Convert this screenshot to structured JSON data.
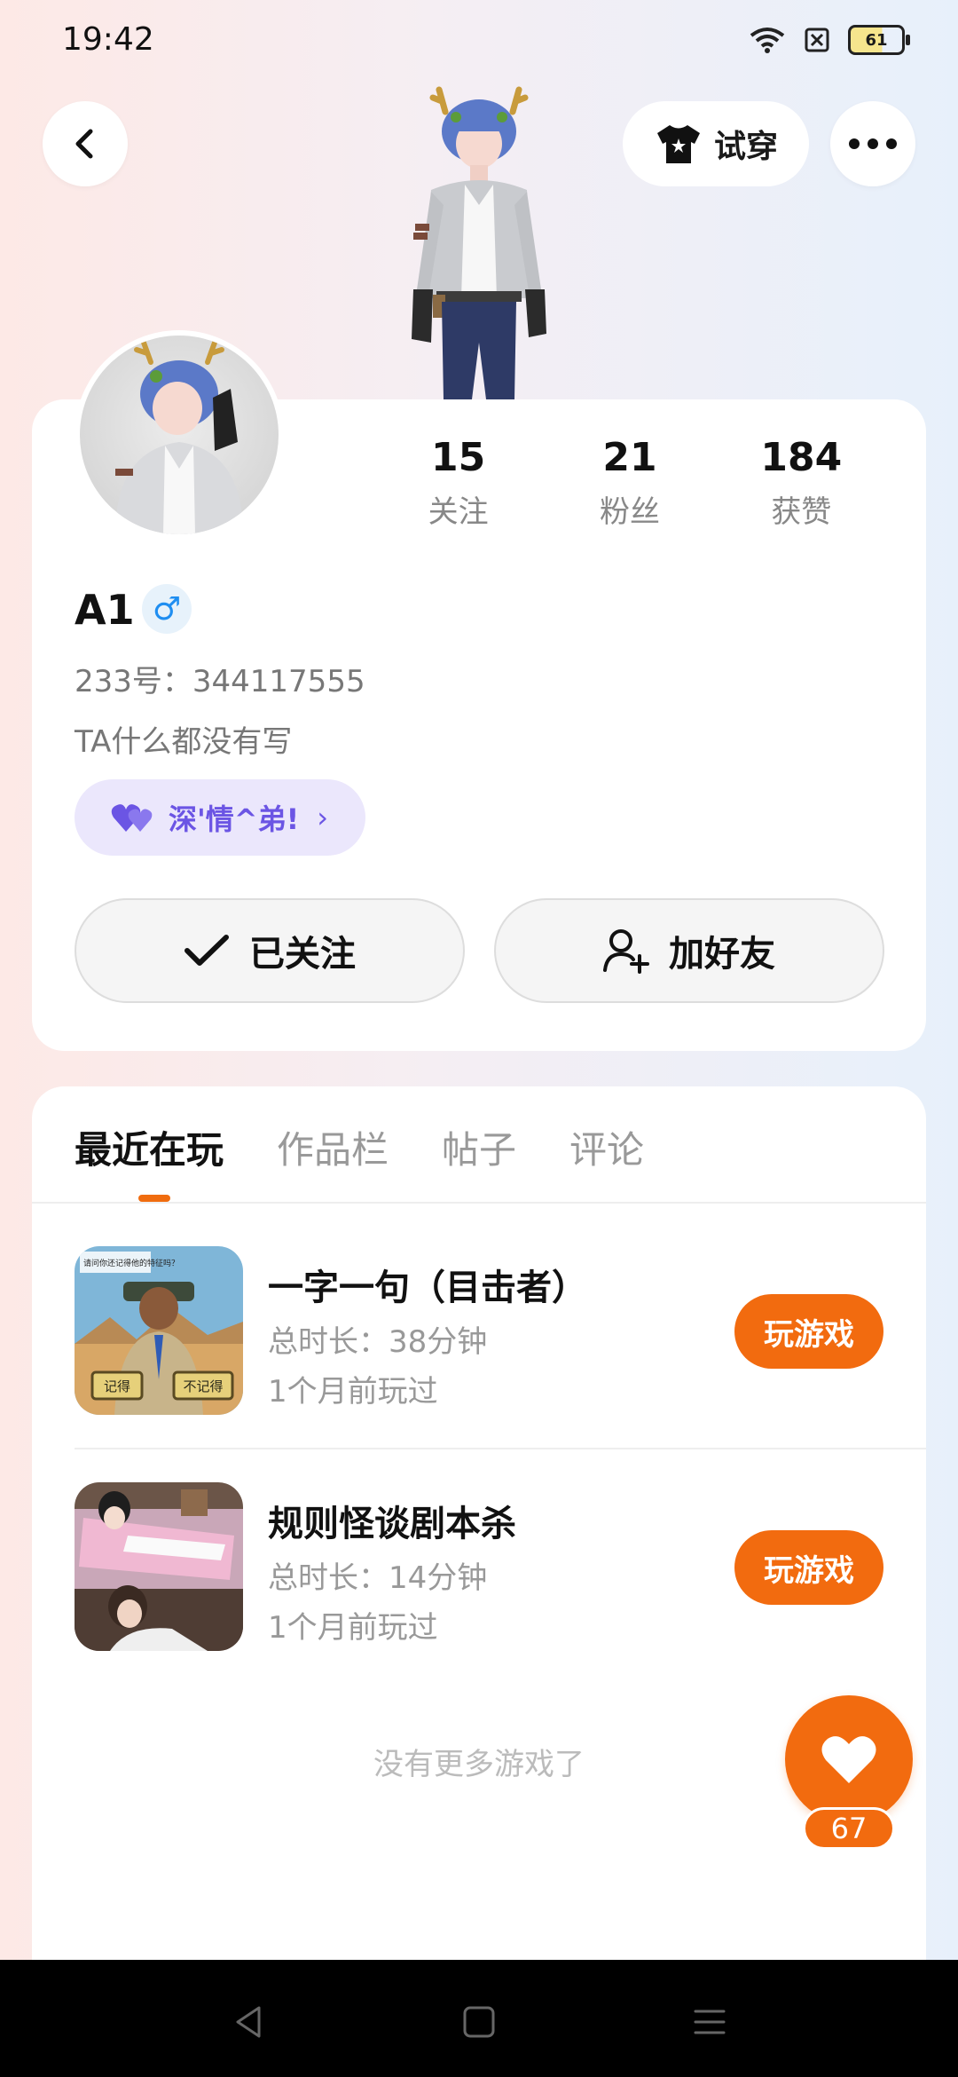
{
  "status_bar": {
    "time": "19:42",
    "battery": "61"
  },
  "header": {
    "tryon_label": "试穿"
  },
  "profile": {
    "username": "A1",
    "gender_symbol": "♂",
    "uid_text": "233号：344117555",
    "bio": "TA什么都没有写",
    "bond_label": "深'情^弟!",
    "stats": [
      {
        "value": "15",
        "label": "关注"
      },
      {
        "value": "21",
        "label": "粉丝"
      },
      {
        "value": "184",
        "label": "获赞"
      }
    ],
    "follow_label": "已关注",
    "add_friend_label": "加好友"
  },
  "tabs": [
    {
      "label": "最近在玩",
      "active": true
    },
    {
      "label": "作品栏",
      "active": false
    },
    {
      "label": "帖子",
      "active": false
    },
    {
      "label": "评论",
      "active": false
    }
  ],
  "games": [
    {
      "title": "一字一句（目击者）",
      "duration": "总时长：38分钟",
      "last_played": "1个月前玩过",
      "play_label": "玩游戏",
      "thumb_text_left": "记得",
      "thumb_text_right": "不记得",
      "thumb_caption": "请问你还记得他的特征吗？"
    },
    {
      "title": "规则怪谈剧本杀",
      "duration": "总时长：14分钟",
      "last_played": "1个月前玩过",
      "play_label": "玩游戏"
    }
  ],
  "no_more_text": "没有更多游戏了",
  "like_count": "67",
  "colors": {
    "accent": "#f26b0f",
    "bond": "#6b55e4",
    "gender": "#1f8ef1"
  }
}
